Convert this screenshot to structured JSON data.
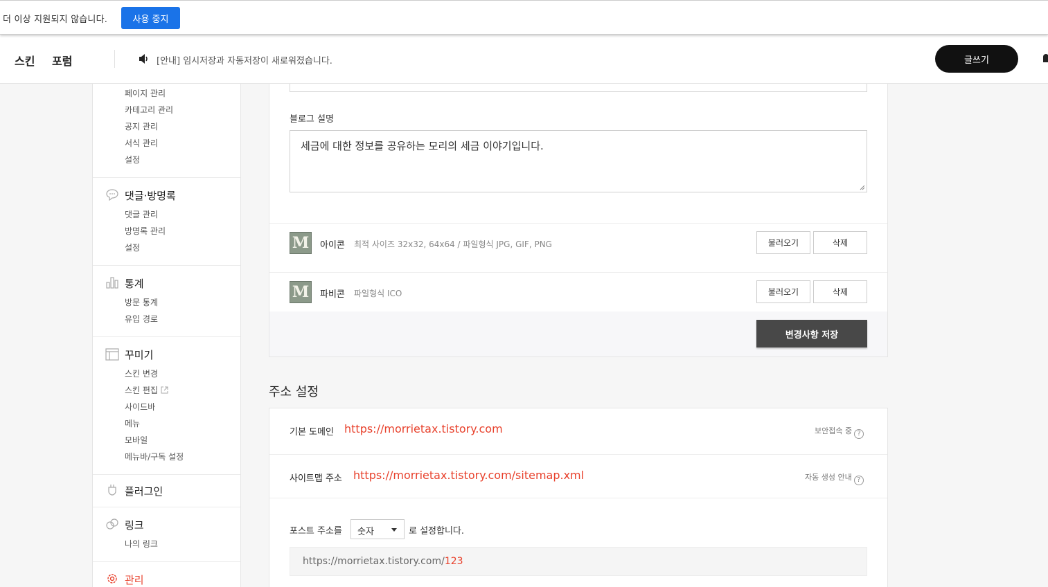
{
  "notice": {
    "text": "더 이상 지원되지 않습니다.",
    "button_label": "사용 중지",
    "button_color": "#1a73e8"
  },
  "header": {
    "nav": [
      "스킨",
      "포럼"
    ],
    "announcement": "[안내] 임시저장과 자동저장이 새로워졌습니다.",
    "write_label": "글쓰기"
  },
  "sidebar": {
    "top_items": [
      "페이지 관리",
      "카테고리 관리",
      "공지 관리",
      "서식 관리",
      "설정"
    ],
    "groups": [
      {
        "title": "댓글·방명록",
        "icon": "comment-icon",
        "items": [
          "댓글 관리",
          "방명록 관리",
          "설정"
        ]
      },
      {
        "title": "통계",
        "icon": "chart-icon",
        "items": [
          "방문 통계",
          "유입 경로"
        ]
      },
      {
        "title": "꾸미기",
        "icon": "layout-icon",
        "items": [
          "스킨 변경",
          "스킨 편집",
          "사이드바",
          "메뉴",
          "모바일",
          "메뉴바/구독 설정"
        ]
      },
      {
        "title": "플러그인",
        "icon": "plug-icon",
        "items": []
      },
      {
        "title": "링크",
        "icon": "link-icon",
        "items": [
          "나의 링크"
        ]
      },
      {
        "title": "관리",
        "icon": "gear-icon",
        "items": [],
        "active_color": "#e8412c"
      }
    ]
  },
  "blog": {
    "desc_label": "블로그 설명",
    "desc_value": "세금에 대한 정보를 공유하는 모리의 세금 이야기입니다.",
    "icon_row": {
      "title": "아이콘",
      "hint": "최적 사이즈 32x32, 64x64 / 파일형식 JPG, GIF, PNG",
      "thumb_letter": "M",
      "load_label": "불러오기",
      "delete_label": "삭제"
    },
    "favicon_row": {
      "title": "파비콘",
      "hint": "파일형식 ICO",
      "thumb_letter": "M",
      "load_label": "불러오기",
      "delete_label": "삭제"
    },
    "save_label": "변경사항 저장"
  },
  "address": {
    "section_title": "주소 설정",
    "domain_label": "기본 도메인",
    "domain_url": "https://morrietax.tistory.com",
    "domain_aside": "보안접속 중",
    "sitemap_label": "사이트맵 주소",
    "sitemap_url": "https://morrietax.tistory.com/sitemap.xml",
    "sitemap_aside": "자동 생성 안내",
    "post_label": "포스트 주소를",
    "post_select": "숫자",
    "post_suffix": "로 설정합니다.",
    "preview_base": "https://morrietax.tistory.com/",
    "preview_num": "123"
  }
}
